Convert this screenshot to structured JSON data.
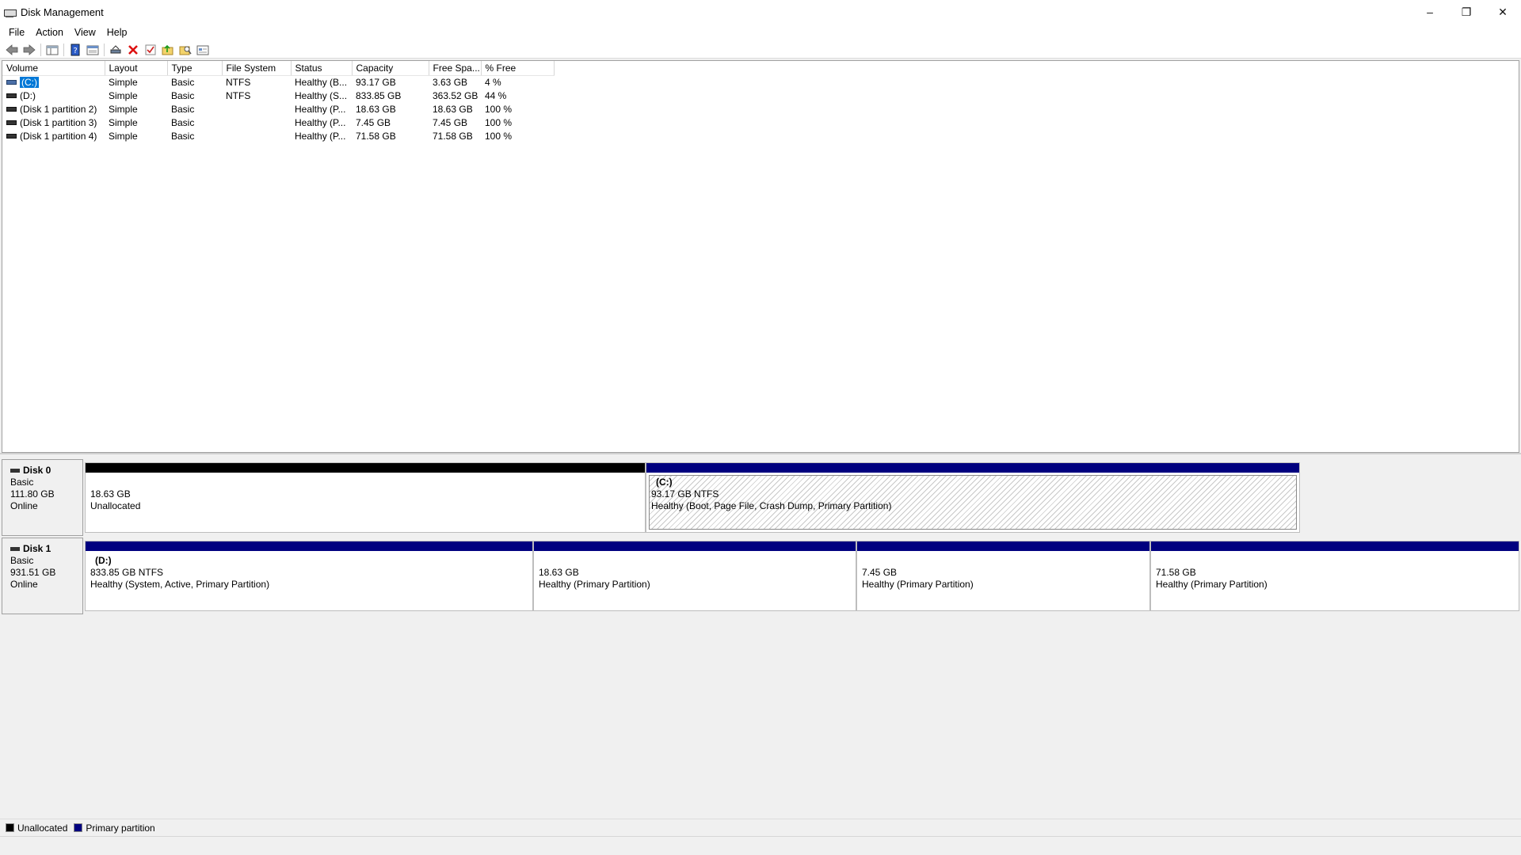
{
  "window": {
    "title": "Disk Management",
    "controls": [
      "–",
      "❐",
      "✕"
    ]
  },
  "menu": [
    "File",
    "Action",
    "View",
    "Help"
  ],
  "toolbar": {
    "icons": [
      "back-icon",
      "forward-icon",
      "show-hide-console-tree-icon",
      "help-icon",
      "properties-icon",
      "connect-icon",
      "delete-icon",
      "check-icon",
      "new-folder-up-icon",
      "search-icon",
      "settings-pane-icon"
    ]
  },
  "volume_table": {
    "headers": [
      "Volume",
      "Layout",
      "Type",
      "File System",
      "Status",
      "Capacity",
      "Free Spa...",
      "% Free"
    ],
    "rows": [
      {
        "volume": "(C:)",
        "layout": "Simple",
        "type": "Basic",
        "fs": "NTFS",
        "status": "Healthy (B...",
        "capacity": "93.17 GB",
        "free": "3.63 GB",
        "pct": "4 %"
      },
      {
        "volume": "(D:)",
        "layout": "Simple",
        "type": "Basic",
        "fs": "NTFS",
        "status": "Healthy (S...",
        "capacity": "833.85 GB",
        "free": "363.52 GB",
        "pct": "44 %"
      },
      {
        "volume": "(Disk 1 partition 2)",
        "layout": "Simple",
        "type": "Basic",
        "fs": "",
        "status": "Healthy (P...",
        "capacity": "18.63 GB",
        "free": "18.63 GB",
        "pct": "100 %"
      },
      {
        "volume": "(Disk 1 partition 3)",
        "layout": "Simple",
        "type": "Basic",
        "fs": "",
        "status": "Healthy (P...",
        "capacity": "7.45 GB",
        "free": "7.45 GB",
        "pct": "100 %"
      },
      {
        "volume": "(Disk 1 partition 4)",
        "layout": "Simple",
        "type": "Basic",
        "fs": "",
        "status": "Healthy (P...",
        "capacity": "71.58 GB",
        "free": "71.58 GB",
        "pct": "100 %"
      }
    ]
  },
  "disks": [
    {
      "name": "Disk 0",
      "kind": "Basic",
      "size": "111.80 GB",
      "state": "Online",
      "partitions": [
        {
          "name": "",
          "size": "18.63 GB",
          "desc": "Unallocated"
        },
        {
          "name": "(C:)",
          "size": "93.17 GB NTFS",
          "desc": "Healthy (Boot, Page File, Crash Dump, Primary Partition)"
        }
      ]
    },
    {
      "name": "Disk 1",
      "kind": "Basic",
      "size": "931.51 GB",
      "state": "Online",
      "partitions": [
        {
          "name": "(D:)",
          "size": "833.85 GB NTFS",
          "desc": "Healthy (System, Active, Primary Partition)"
        },
        {
          "name": "",
          "size": "18.63 GB",
          "desc": "Healthy (Primary Partition)"
        },
        {
          "name": "",
          "size": "7.45 GB",
          "desc": "Healthy (Primary Partition)"
        },
        {
          "name": "",
          "size": "71.58 GB",
          "desc": "Healthy (Primary Partition)"
        }
      ]
    }
  ],
  "legend": [
    {
      "label": "Unallocated",
      "color": "#000000"
    },
    {
      "label": "Primary partition",
      "color": "#00007f"
    }
  ]
}
